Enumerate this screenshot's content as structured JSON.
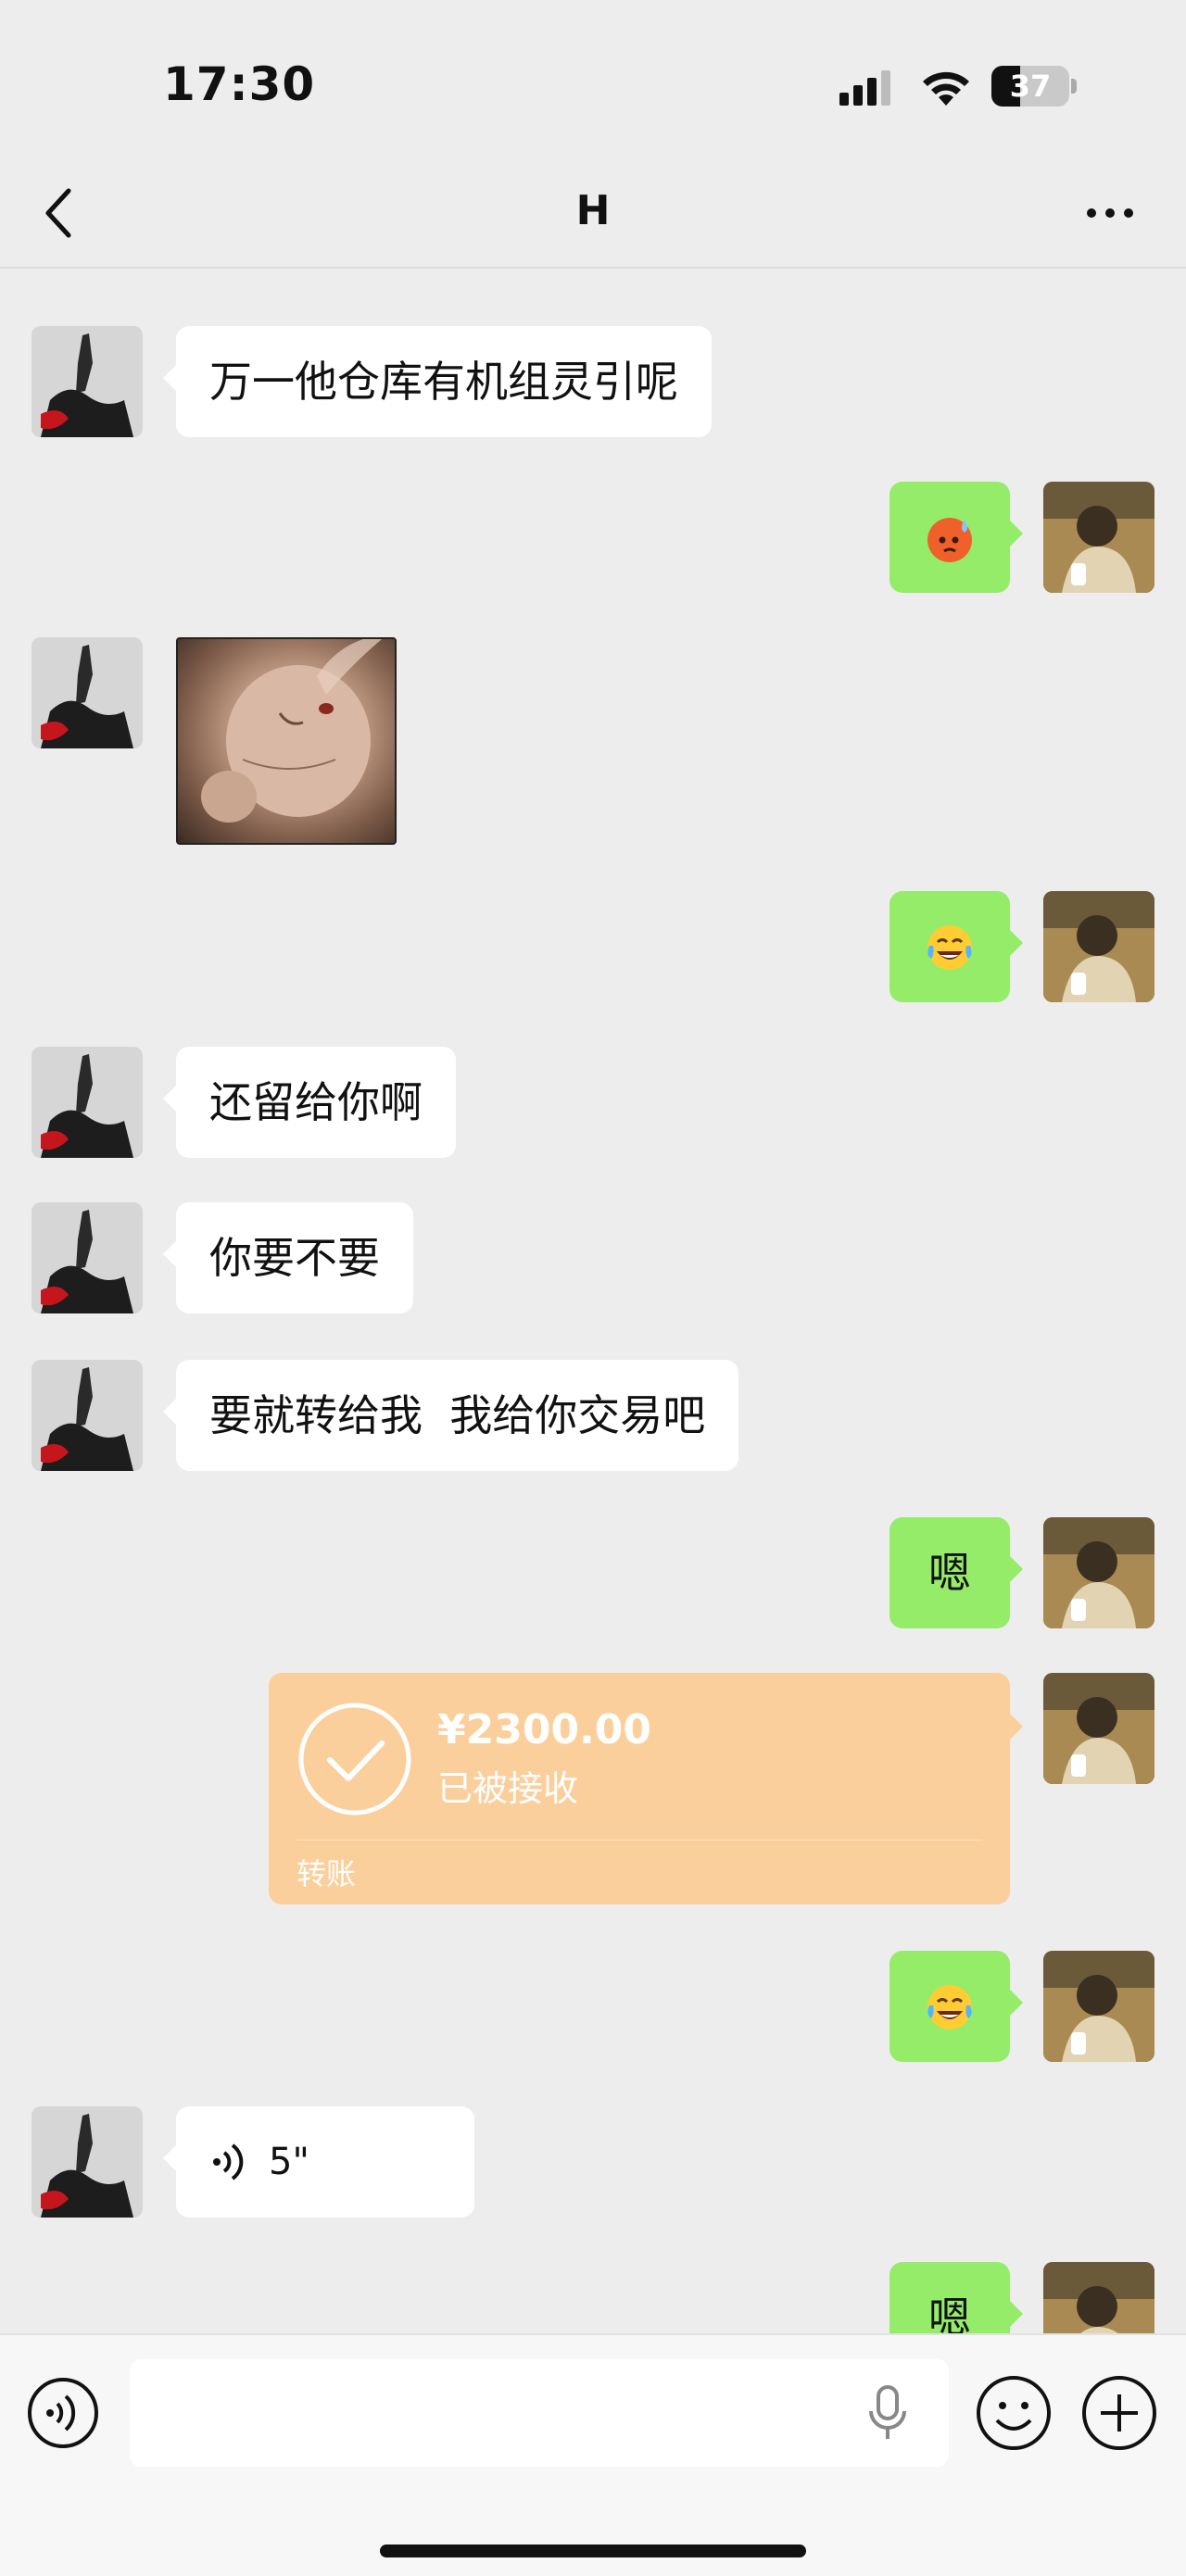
{
  "status": {
    "time": "17:30",
    "battery": "37",
    "battery_level": 0.37
  },
  "nav": {
    "title": "H"
  },
  "messages": {
    "m1": {
      "text": "万一他仓库有机组灵引呢"
    },
    "m2": {
      "emoji": "cold-sweat-face"
    },
    "m3": {
      "sticker": "face-sticker"
    },
    "m4": {
      "emoji": "tears-of-joy-face"
    },
    "m5": {
      "text": "还留给你啊"
    },
    "m6": {
      "text": "你要不要"
    },
    "m7": {
      "text": "要就转给我  我给你交易吧"
    },
    "m8": {
      "text": "嗯"
    },
    "m9": {
      "amount": "¥2300.00",
      "status": "已被接收",
      "label": "转账"
    },
    "m10": {
      "emoji": "tears-of-joy-face"
    },
    "m11": {
      "duration": "5\""
    },
    "m12": {
      "text": "嗯"
    }
  },
  "input": {
    "placeholder": ""
  },
  "colors": {
    "sent_bubble": "#95ec69",
    "received_bubble": "#ffffff",
    "transfer": "#fbcf9b",
    "background": "#ededed"
  }
}
